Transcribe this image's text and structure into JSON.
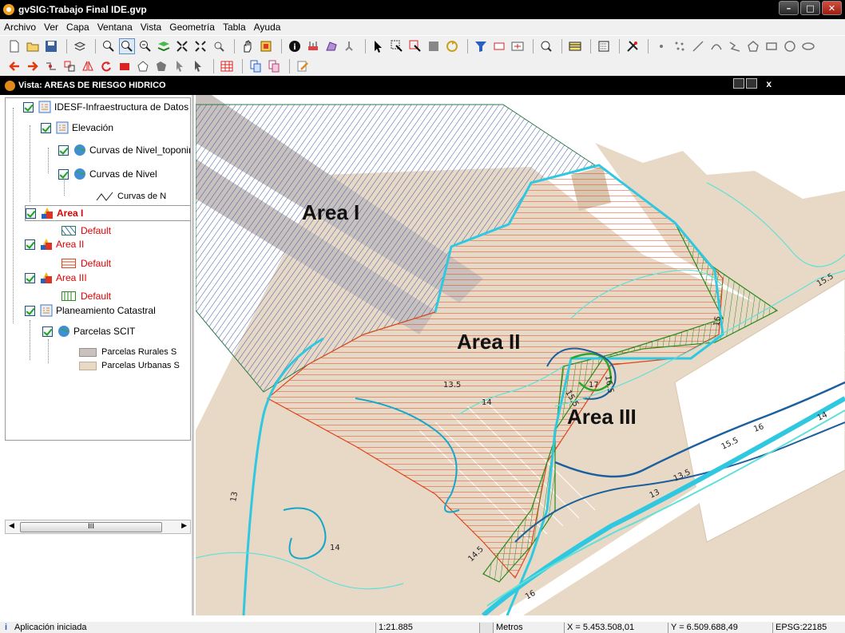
{
  "app": {
    "window_title": "gvSIG:Trabajo Final IDE.gvp"
  },
  "menu": [
    "Archivo",
    "Ver",
    "Capa",
    "Ventana",
    "Vista",
    "Geometría",
    "Tabla",
    "Ayuda"
  ],
  "view": {
    "title": "Vista: AREAS DE RIESGO HIDRICO",
    "close_glyph": "x"
  },
  "toc": {
    "layers": [
      {
        "label": "IDESF-Infraestructura de Datos"
      },
      {
        "label": "Elevación"
      },
      {
        "label": "Curvas de Nivel_toponim"
      },
      {
        "label": "Curvas de Nivel"
      },
      {
        "label": "Curvas de N"
      },
      {
        "label": "Area I"
      },
      {
        "label": "Default"
      },
      {
        "label": "Area II"
      },
      {
        "label": "Default"
      },
      {
        "label": "Area III"
      },
      {
        "label": "Default"
      },
      {
        "label": "Planeamiento Catastral"
      },
      {
        "label": "Parcelas SCIT"
      },
      {
        "label": "Parcelas Rurales S"
      },
      {
        "label": "Parcelas Urbanas S"
      }
    ],
    "scroll_thumb": "III"
  },
  "map": {
    "area_labels": [
      "Area I",
      "Area II",
      "Area III"
    ],
    "contour_labels": [
      "15.5",
      "15",
      "13.5",
      "14",
      "15.5",
      "16.5",
      "17",
      "14",
      "16",
      "15.5",
      "13.5",
      "13",
      "13",
      "14",
      "14.5",
      "16"
    ],
    "colors": {
      "area1": "#3a57a8",
      "area2": "#e0451c",
      "area3": "#2a8a1c",
      "parcel_urban": "#e8d9c6",
      "parcel_rural": "#c9c1bd",
      "contour_light": "#5fe0d8",
      "contour_main": "#17a6c9",
      "contour_dark": "#1b5f9e",
      "river": "#30c8e0"
    }
  },
  "status": {
    "message": "Aplicación iniciada",
    "scale": "1:21.885",
    "units": "Metros",
    "x": "X = 5.453.508,01",
    "y": "Y = 6.509.688,49",
    "crs": "EPSG:22185"
  }
}
